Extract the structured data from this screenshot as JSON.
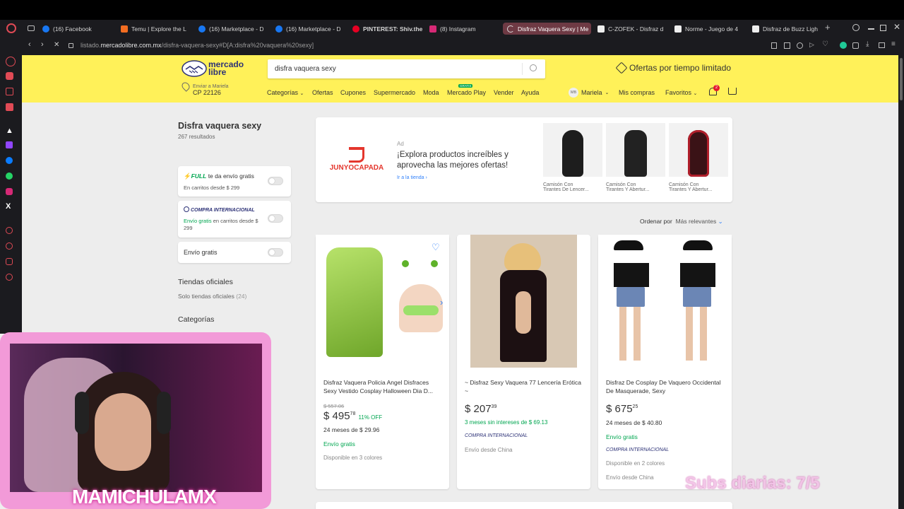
{
  "tabs": [
    {
      "label": "(16) Facebook",
      "color": "#1877f2"
    },
    {
      "label": "Temu | Explore the L",
      "color": "#f36d21"
    },
    {
      "label": "(16) Marketplace - D",
      "color": "#1877f2"
    },
    {
      "label": "(16) Marketplace - D",
      "color": "#1877f2"
    },
    {
      "label": "PINTEREST: Shiv.the",
      "color": "#e60023"
    },
    {
      "label": "(8) Instagram",
      "color": "#d62976"
    },
    {
      "label": "Disfraz Vaquera Sexy | Me",
      "color": "#ffe600"
    },
    {
      "label": "C-ZOFEK - Disfraz d",
      "color": "#eeeeee"
    },
    {
      "label": "Norme - Juego de 4",
      "color": "#eeeeee"
    },
    {
      "label": "Disfraz de Buzz Ligh",
      "color": "#eeeeee"
    }
  ],
  "address": {
    "prefix": "listado.",
    "domain": "mercadolibre.com.mx",
    "path": "/disfra-vaquera-sexy#D[A:disfra%20vaquera%20sexy]"
  },
  "ml": {
    "logo_line1": "mercado",
    "logo_line2": "libre",
    "search_value": "disfra vaquera sexy",
    "promo": "Ofertas por tiempo limitado",
    "ship_to": "Enviar a Mariela",
    "cp": "CP 22126",
    "nav": [
      "Categorías",
      "Ofertas",
      "Cupones",
      "Supermercado",
      "Moda",
      "Mercado Play",
      "Vender",
      "Ayuda"
    ],
    "nav_badge": "GRATIS",
    "user_initials": "MB",
    "user": "Mariela",
    "mis_compras": "Mis compras",
    "favoritos": "Favoritos",
    "notif_count": "2"
  },
  "filters": {
    "query_title": "Disfra vaquera sexy",
    "results": "267 resultados",
    "full_label": "FULL",
    "full_text": "te da envío gratis",
    "full_sub": "En carritos desde $ 299",
    "intl_label": "COMPRA INTERNACIONAL",
    "intl_green": "Envío gratis",
    "intl_text": "en carritos desde $",
    "intl_amount": "299",
    "free_ship": "Envío gratis",
    "official_title": "Tiendas oficiales",
    "official_sub": "Solo tiendas oficiales",
    "official_count": "(24)",
    "categories": "Categorías"
  },
  "ad": {
    "tag": "Ad",
    "brand": "JUNYOCAPADA",
    "headline": "¡Explora productos increíbles y aprovecha las mejores ofertas!",
    "link": "Ir a la tienda",
    "items": [
      {
        "l1": "Camisón Con",
        "l2": "Tirantes De Lencer..."
      },
      {
        "l1": "Camisón Con",
        "l2": "Tirantes Y Abertur..."
      },
      {
        "l1": "Camisón Con",
        "l2": "Tirantes Y Abertur..."
      }
    ]
  },
  "sort": {
    "label": "Ordenar por",
    "value": "Más relevantes"
  },
  "products": [
    {
      "title": "Disfraz Vaquera Policia Angel Disfraces Sexy Vestido Cosplay Halloween Dia D...",
      "old_price": "$ 557.06",
      "price": "$ 495",
      "cents": "78",
      "discount": "11% OFF",
      "installments": "24 meses de $ 29.96",
      "shipping": "Envío gratis",
      "intl": "",
      "origin": "",
      "colors": "Disponible en 3 colores"
    },
    {
      "title": "~ Disfraz Sexy Vaquera 77 Lencería Erótica ~",
      "old_price": "",
      "price": "$ 207",
      "cents": "39",
      "discount": "",
      "installments": "3 meses sin intereses de $ 69.13",
      "shipping": "",
      "intl": "COMPRA INTERNACIONAL",
      "origin": "Envío desde China",
      "colors": ""
    },
    {
      "title": "Disfraz De Cosplay De Vaquero Occidental De Masquerade, Sexy",
      "old_price": "",
      "price": "$ 675",
      "cents": "25",
      "discount": "",
      "installments": "24 meses de $ 40.80",
      "shipping": "Envío gratis",
      "intl": "COMPRA INTERNACIONAL",
      "origin": "Envío desde China",
      "colors": "Disponible en 2 colores"
    }
  ],
  "overlay": {
    "streamer": "MAMICHULAMX",
    "subs": "Subs diarias: 7/5"
  }
}
